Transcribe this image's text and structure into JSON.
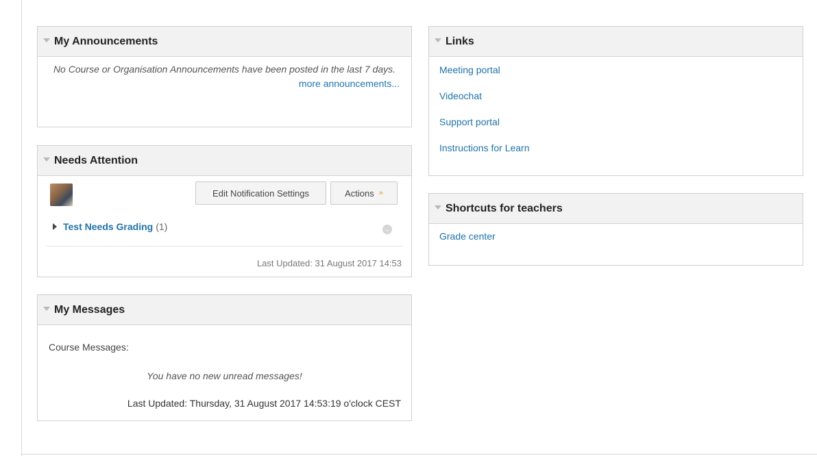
{
  "announcements": {
    "title": "My Announcements",
    "empty_text": "No Course or Organisation Announcements have been posted in the last 7 days.",
    "more_link": "more announcements..."
  },
  "needs_attention": {
    "title": "Needs Attention",
    "edit_button": "Edit Notification Settings",
    "actions_button": "Actions",
    "item_label": "Test Needs Grading",
    "item_count": "(1)",
    "last_updated": "Last Updated: 31 August 2017 14:53"
  },
  "messages": {
    "title": "My Messages",
    "course_label": "Course Messages:",
    "empty_text": "You have no new unread messages!",
    "last_updated": "Last Updated: Thursday, 31 August 2017 14:53:19 o'clock CEST"
  },
  "links": {
    "title": "Links",
    "items": [
      {
        "label": "Meeting portal"
      },
      {
        "label": "Videochat"
      },
      {
        "label": "Support portal"
      },
      {
        "label": "Instructions for Learn"
      }
    ]
  },
  "shortcuts": {
    "title": "Shortcuts for teachers",
    "items": [
      {
        "label": "Grade center"
      }
    ]
  },
  "colors": {
    "link": "#1f73a8",
    "header_bg": "#f2f2f2",
    "actions_chevron": "#d4a017"
  }
}
